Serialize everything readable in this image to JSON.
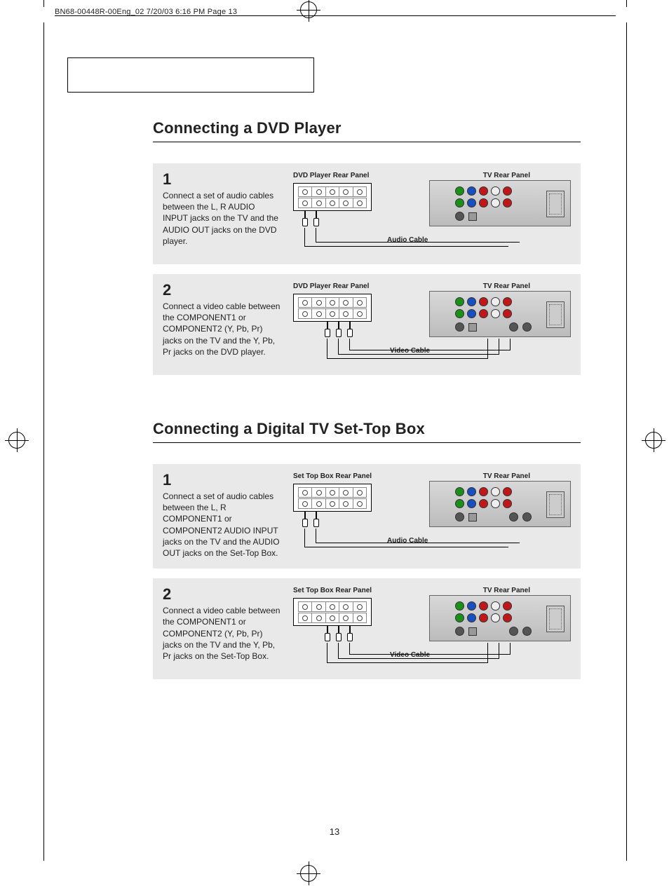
{
  "print_header": "BN68-00448R-00Eng_02  7/20/03 6:16 PM  Page 13",
  "page_number": "13",
  "sections": [
    {
      "heading": "Connecting a DVD Player",
      "steps": [
        {
          "num": "1",
          "text": "Connect a set of audio cables between the L, R AUDIO INPUT jacks on the TV and the AUDIO OUT jacks on the DVD player.",
          "left_panel_label": "DVD Player Rear Panel",
          "right_panel_label": "TV Rear Panel",
          "cable_label": "Audio Cable",
          "plugs": 2
        },
        {
          "num": "2",
          "text": "Connect a video cable between the COMPONENT1 or COMPONENT2 (Y, Pb, Pr) jacks on the TV and the Y, Pb, Pr jacks on the DVD player.",
          "left_panel_label": "DVD Player Rear Panel",
          "right_panel_label": "TV Rear Panel",
          "cable_label": "Video Cable",
          "plugs": 3
        }
      ]
    },
    {
      "heading": "Connecting a Digital TV Set-Top Box",
      "steps": [
        {
          "num": "1",
          "text": "Connect a set of audio cables between the L, R COMPONENT1 or COMPONENT2 AUDIO INPUT jacks on the TV and the AUDIO OUT jacks on the Set-Top Box.",
          "left_panel_label": "Set Top Box Rear Panel",
          "right_panel_label": "TV Rear Panel",
          "cable_label": "Audio Cable",
          "plugs": 2
        },
        {
          "num": "2",
          "text": "Connect a video cable between the COMPONENT1 or COMPONENT2 (Y, Pb, Pr) jacks on the TV and the Y, Pb, Pr jacks on the Set-Top Box.",
          "left_panel_label": "Set Top Box Rear Panel",
          "right_panel_label": "TV Rear Panel",
          "cable_label": "Video Cable",
          "plugs": 3
        }
      ]
    }
  ]
}
